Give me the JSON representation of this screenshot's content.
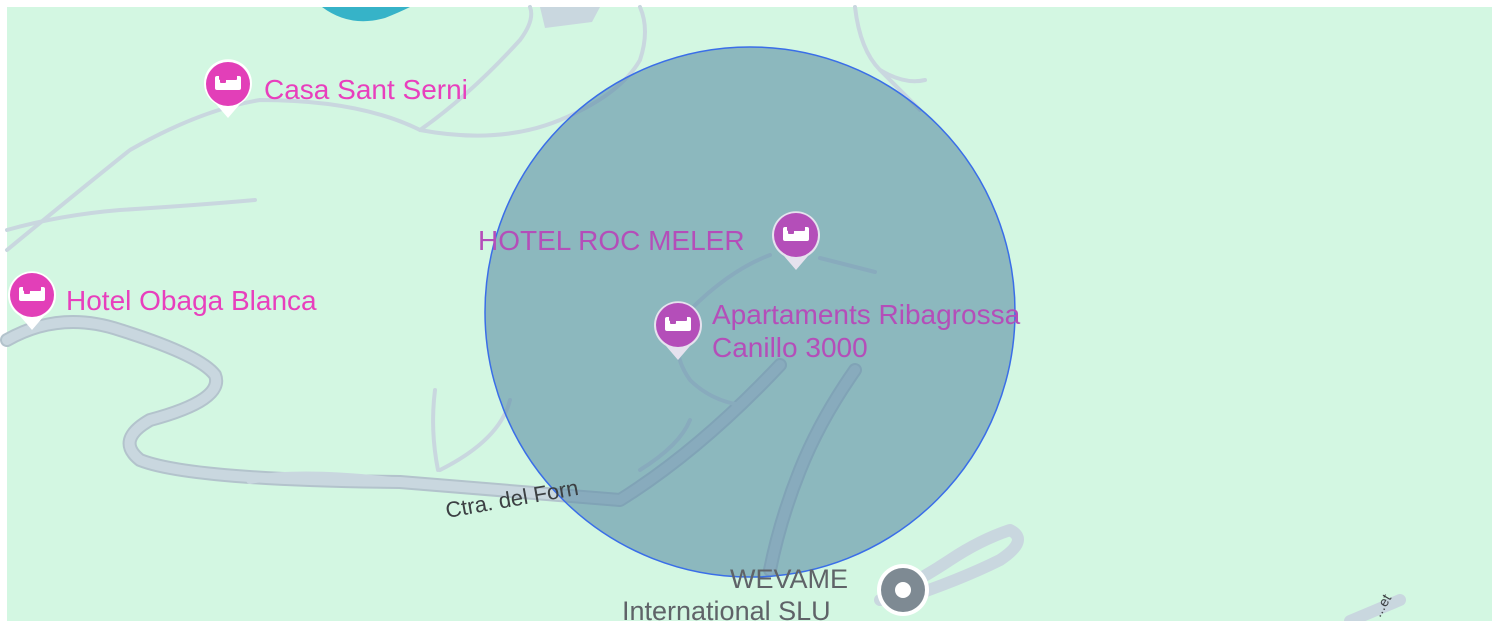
{
  "map": {
    "land_color": "#d3f7e2",
    "road_color": "#c4d3dc",
    "road_edge_color": "#b3c3cc",
    "water_color": "#36b3c8",
    "radius_fill_color": "#5e8ea6",
    "radius_stroke_color": "#3a6ee8",
    "hotel_marker_color": "#e23fb8",
    "hotel_marker_in_circle_color": "#b44eb9",
    "business_marker_color": "#7e8a93"
  },
  "places": [
    {
      "name": "Casa Sant Serni",
      "type": "hotel",
      "icon": "bed-icon"
    },
    {
      "name": "HOTEL ROC MELER",
      "type": "hotel",
      "icon": "bed-icon"
    },
    {
      "name": "Hotel Obaga Blanca",
      "type": "hotel",
      "icon": "bed-icon"
    },
    {
      "name_line1": "Apartaments Ribagrossa",
      "name_line2": "Canillo 3000",
      "type": "hotel",
      "icon": "bed-icon"
    },
    {
      "name_line1": "WEVAME",
      "name_line2": "International SLU",
      "type": "business",
      "icon": "place-icon"
    }
  ],
  "roads": [
    {
      "name": "Ctra. del Forn"
    },
    {
      "name": "...et"
    }
  ]
}
